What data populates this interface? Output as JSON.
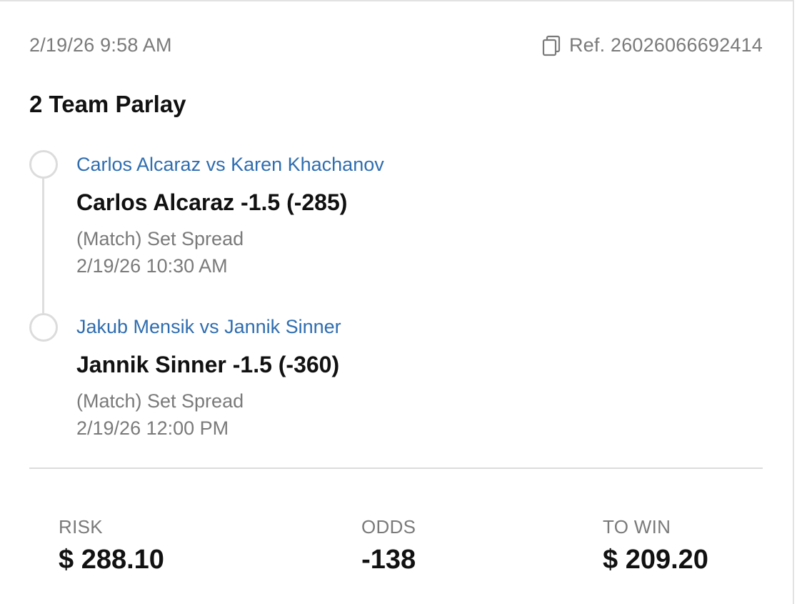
{
  "header": {
    "datetime": "2/19/26 9:58 AM",
    "ref_label": "Ref. 26026066692414",
    "copy_icon": "copy-icon"
  },
  "bet": {
    "title": "2 Team Parlay",
    "legs": [
      {
        "matchup": "Carlos Alcaraz vs Karen Khachanov",
        "pick": "Carlos Alcaraz -1.5 (-285)",
        "market": "(Match) Set Spread",
        "time": "2/19/26 10:30 AM"
      },
      {
        "matchup": "Jakub Mensik vs Jannik Sinner",
        "pick": "Jannik Sinner -1.5 (-360)",
        "market": "(Match) Set Spread",
        "time": "2/19/26 12:00 PM"
      }
    ]
  },
  "summary": {
    "risk_label": "RISK",
    "risk_value": "$ 288.10",
    "odds_label": "ODDS",
    "odds_value": "-138",
    "towin_label": "TO WIN",
    "towin_value": "$ 209.20"
  },
  "colors": {
    "link": "#2f6db0",
    "muted": "#7a7a7a",
    "text": "#111111",
    "divider": "#dcdcdc"
  }
}
